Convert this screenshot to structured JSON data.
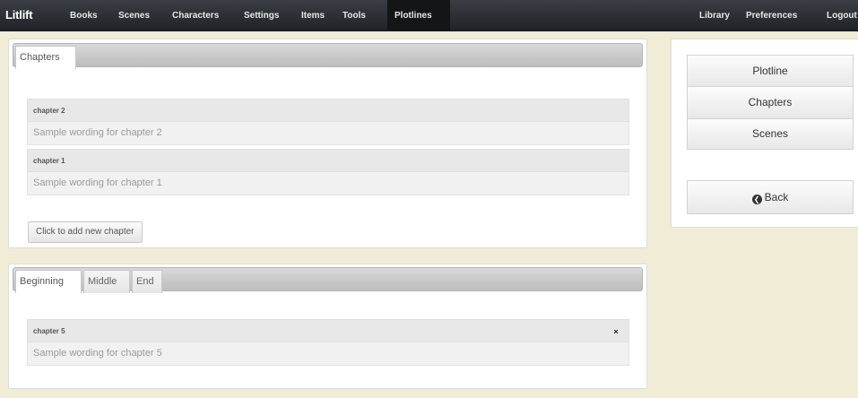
{
  "navbar": {
    "brand": "Litlift",
    "items": [
      "Books",
      "Scenes",
      "Characters",
      "Settings",
      "Items",
      "Tools",
      "Plotlines"
    ],
    "active": "Plotlines",
    "right_items": [
      "Library",
      "Preferences",
      "Logout"
    ]
  },
  "chapters_panel": {
    "tab_label": "Chapters",
    "chapters": [
      {
        "title": "chapter 2",
        "text": "Sample wording for chapter 2"
      },
      {
        "title": "chapter 1",
        "text": "Sample wording for chapter 1"
      }
    ],
    "add_button_label": "Click to add new chapter"
  },
  "plot_panel": {
    "tabs": [
      "Beginning",
      "Middle",
      "End"
    ],
    "active_tab": "Beginning",
    "chapter": {
      "title": "chapter 5",
      "text": "Sample wording for chapter 5",
      "close_symbol": "×"
    }
  },
  "side_menu": {
    "items": [
      "Plotline",
      "Chapters",
      "Scenes"
    ],
    "back_label": "Back",
    "back_icon": "back-circle-arrow-icon"
  },
  "colors": {
    "page_background": "#f0ecd5",
    "navbar": "#2a2e33",
    "panel_background": "#ffffff"
  }
}
